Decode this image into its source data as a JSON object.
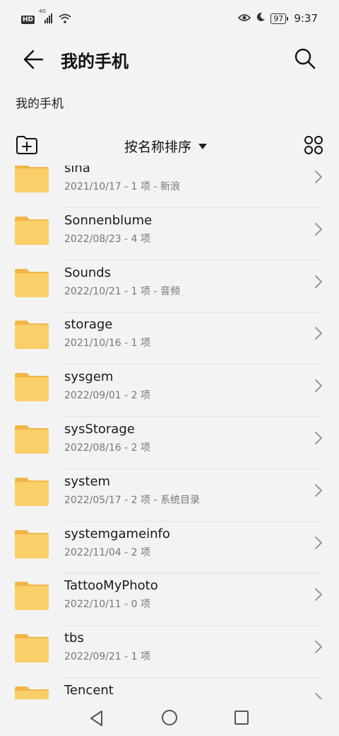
{
  "status_bar": {
    "network": "4G",
    "hd": "HD",
    "battery": "97",
    "time": "9:37"
  },
  "header": {
    "title": "我的手机"
  },
  "breadcrumb": "我的手机",
  "toolbar": {
    "sort_label": "按名称排序"
  },
  "files": [
    {
      "name": "sina",
      "meta": "2021/10/17 - 1 项 - 新浪"
    },
    {
      "name": "Sonnenblume",
      "meta": "2022/08/23 - 4 项"
    },
    {
      "name": "Sounds",
      "meta": "2022/10/21 - 1 项 - 音频"
    },
    {
      "name": "storage",
      "meta": "2021/10/16 - 1 项"
    },
    {
      "name": "sysgem",
      "meta": "2022/09/01 - 2 项"
    },
    {
      "name": "sysStorage",
      "meta": "2022/08/16 - 2 项"
    },
    {
      "name": "system",
      "meta": "2022/05/17 - 2 项 - 系统目录"
    },
    {
      "name": "systemgameinfo",
      "meta": "2022/11/04 - 2 项"
    },
    {
      "name": "TattooMyPhoto",
      "meta": "2022/10/11 - 0 项"
    },
    {
      "name": "tbs",
      "meta": "2022/09/21 - 1 项"
    },
    {
      "name": "Tencent",
      "meta": ""
    }
  ],
  "colors": {
    "folder": "#f9cf6a",
    "folder_tab": "#f0b64a",
    "background": "#f3f3f3"
  }
}
